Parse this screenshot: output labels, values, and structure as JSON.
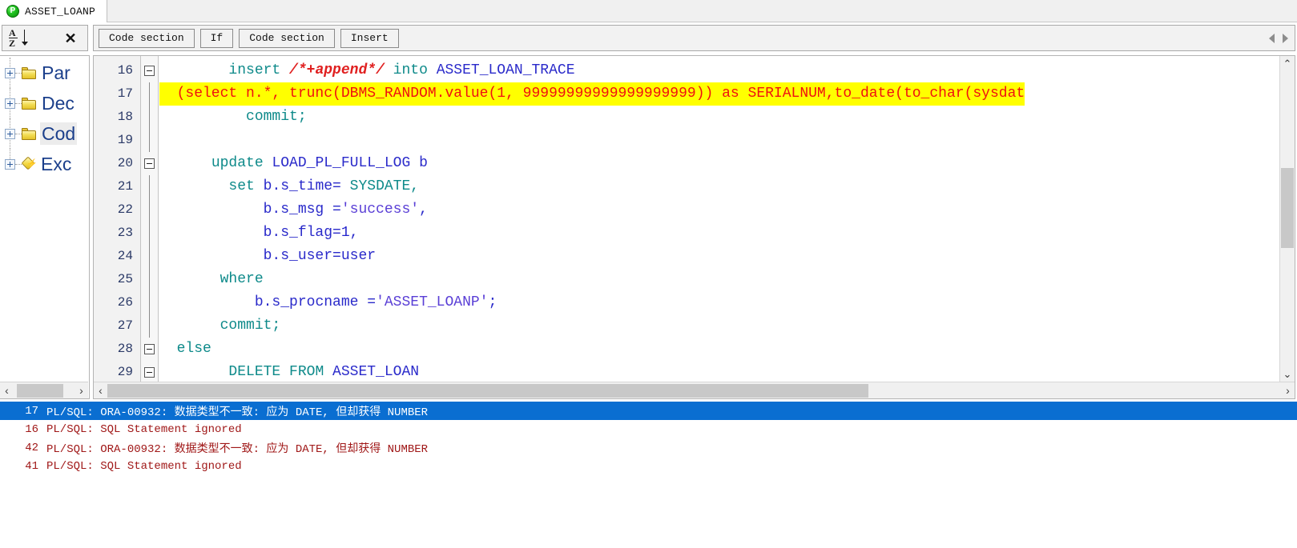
{
  "window": {
    "tab": {
      "title": "ASSET_LOANP",
      "icon": "procedure-icon"
    }
  },
  "toolbar_left": {
    "sort_icon": "sort-az-icon",
    "close_icon": "close-icon"
  },
  "toolbar_right": {
    "buttons": [
      {
        "label": "Code section"
      },
      {
        "label": "If"
      },
      {
        "label": "Code section"
      },
      {
        "label": "Insert"
      }
    ],
    "nav_prev_icon": "nav-left-icon",
    "nav_next_icon": "nav-right-icon"
  },
  "tree": {
    "items": [
      {
        "label": "Par",
        "icon": "folder-icon",
        "expander": "plus",
        "selected": false
      },
      {
        "label": "Dec",
        "icon": "folder-icon",
        "expander": "plus",
        "selected": false
      },
      {
        "label": "Cod",
        "icon": "folder-icon",
        "expander": "plus",
        "selected": true
      },
      {
        "label": "Exc",
        "icon": "exception-diamond-icon",
        "expander": "plus",
        "selected": false
      }
    ],
    "hscroll": {
      "left_arrow": "‹",
      "right_arrow": "›"
    }
  },
  "editor": {
    "lines": [
      {
        "number": "16",
        "fold": true,
        "highlight": false,
        "tokens": [
          {
            "t": "        ",
            "c": "plain"
          },
          {
            "t": "insert ",
            "c": "kw"
          },
          {
            "t": "/*+append*/",
            "c": "cmt"
          },
          {
            "t": " into ",
            "c": "kw"
          },
          {
            "t": "ASSET_LOAN_TRACE",
            "c": "idf"
          }
        ]
      },
      {
        "number": "17",
        "fold": false,
        "highlight": true,
        "tokens": [
          {
            "t": "  (select n.*, trunc(DBMS_RANDOM.value(1, 99999999999999999999)) as SERIALNUM,to_date(to_char(sysdat",
            "c": "err"
          }
        ]
      },
      {
        "number": "18",
        "fold": false,
        "highlight": false,
        "tokens": [
          {
            "t": "          ",
            "c": "plain"
          },
          {
            "t": "commit;",
            "c": "kw"
          }
        ]
      },
      {
        "number": "19",
        "fold": false,
        "highlight": false,
        "tokens": []
      },
      {
        "number": "20",
        "fold": true,
        "highlight": false,
        "tokens": [
          {
            "t": "      ",
            "c": "plain"
          },
          {
            "t": "update ",
            "c": "kw"
          },
          {
            "t": "LOAD_PL_FULL_LOG b",
            "c": "idf"
          }
        ]
      },
      {
        "number": "21",
        "fold": false,
        "highlight": false,
        "tokens": [
          {
            "t": "        ",
            "c": "plain"
          },
          {
            "t": "set ",
            "c": "kw"
          },
          {
            "t": "b.s_time= ",
            "c": "idf"
          },
          {
            "t": "SYSDATE,",
            "c": "kw"
          }
        ]
      },
      {
        "number": "22",
        "fold": false,
        "highlight": false,
        "tokens": [
          {
            "t": "            ",
            "c": "plain"
          },
          {
            "t": "b.s_msg =",
            "c": "idf"
          },
          {
            "t": "'success'",
            "c": "str"
          },
          {
            "t": ",",
            "c": "idf"
          }
        ]
      },
      {
        "number": "23",
        "fold": false,
        "highlight": false,
        "tokens": [
          {
            "t": "            ",
            "c": "plain"
          },
          {
            "t": "b.s_flag=",
            "c": "idf"
          },
          {
            "t": "1",
            "c": "num"
          },
          {
            "t": ",",
            "c": "idf"
          }
        ]
      },
      {
        "number": "24",
        "fold": false,
        "highlight": false,
        "tokens": [
          {
            "t": "            ",
            "c": "plain"
          },
          {
            "t": "b.s_user=user",
            "c": "idf"
          }
        ]
      },
      {
        "number": "25",
        "fold": false,
        "highlight": false,
        "tokens": [
          {
            "t": "       ",
            "c": "plain"
          },
          {
            "t": "where",
            "c": "kw"
          }
        ]
      },
      {
        "number": "26",
        "fold": false,
        "highlight": false,
        "tokens": [
          {
            "t": "           ",
            "c": "plain"
          },
          {
            "t": "b.s_procname =",
            "c": "idf"
          },
          {
            "t": "'ASSET_LOANP'",
            "c": "str"
          },
          {
            "t": ";",
            "c": "idf"
          }
        ]
      },
      {
        "number": "27",
        "fold": false,
        "highlight": false,
        "tokens": [
          {
            "t": "       ",
            "c": "plain"
          },
          {
            "t": "commit;",
            "c": "kw"
          }
        ]
      },
      {
        "number": "28",
        "fold": true,
        "highlight": false,
        "tokens": [
          {
            "t": "  ",
            "c": "plain"
          },
          {
            "t": "else",
            "c": "kw"
          }
        ]
      },
      {
        "number": "29",
        "fold": true,
        "highlight": false,
        "tokens": [
          {
            "t": "        ",
            "c": "plain"
          },
          {
            "t": "DELETE FROM ",
            "c": "kw"
          },
          {
            "t": "ASSET_LOAN",
            "c": "idf"
          }
        ]
      }
    ],
    "vscroll": {
      "up_arrow": "⌃",
      "down_arrow": "⌄"
    },
    "hscroll": {
      "left_arrow": "‹",
      "right_arrow": "›"
    }
  },
  "errors": {
    "rows": [
      {
        "line": "17",
        "message": "PL/SQL: ORA-00932: 数据类型不一致: 应为 DATE, 但却获得 NUMBER",
        "selected": true
      },
      {
        "line": "16",
        "message": "PL/SQL: SQL Statement ignored",
        "selected": false
      },
      {
        "line": "42",
        "message": "PL/SQL: ORA-00932: 数据类型不一致: 应为 DATE, 但却获得 NUMBER",
        "selected": false
      },
      {
        "line": "41",
        "message": "PL/SQL: SQL Statement ignored",
        "selected": false
      }
    ]
  },
  "colors": {
    "selection_blue": "#0a6ed1",
    "error_red": "#a01818",
    "highlight_yellow": "#ffff00",
    "keyword_teal": "#0e8a8a",
    "identifier_blue": "#2a2aca",
    "string_purple": "#5a3fd6",
    "comment_red": "#e02020"
  }
}
